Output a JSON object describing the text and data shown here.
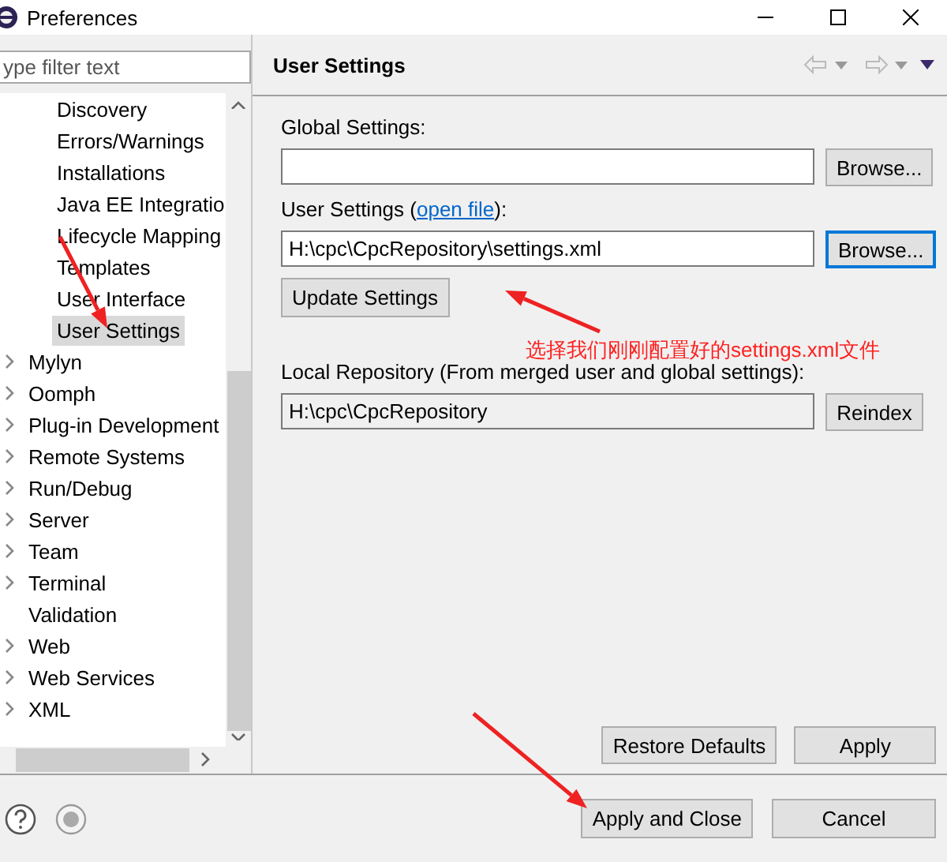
{
  "window": {
    "title": "Preferences"
  },
  "filter": {
    "placeholder": "ype filter text"
  },
  "tree": {
    "scrolled_children": [
      {
        "label": "Discovery",
        "selected": false
      },
      {
        "label": "Errors/Warnings",
        "selected": false
      },
      {
        "label": "Installations",
        "selected": false
      },
      {
        "label": "Java EE Integratio",
        "selected": false
      },
      {
        "label": "Lifecycle Mapping",
        "selected": false
      },
      {
        "label": "Templates",
        "selected": false
      },
      {
        "label": "User Interface",
        "selected": false
      },
      {
        "label": "User Settings",
        "selected": true
      }
    ],
    "items": [
      {
        "label": "Mylyn",
        "expandable": true,
        "selected": false
      },
      {
        "label": "Oomph",
        "expandable": true,
        "selected": false
      },
      {
        "label": "Plug-in Development",
        "expandable": true,
        "selected": false
      },
      {
        "label": "Remote Systems",
        "expandable": true,
        "selected": false
      },
      {
        "label": "Run/Debug",
        "expandable": true,
        "selected": false
      },
      {
        "label": "Server",
        "expandable": true,
        "selected": false
      },
      {
        "label": "Team",
        "expandable": true,
        "selected": false
      },
      {
        "label": "Terminal",
        "expandable": true,
        "selected": false
      },
      {
        "label": "Validation",
        "expandable": false,
        "selected": false
      },
      {
        "label": "Web",
        "expandable": true,
        "selected": false
      },
      {
        "label": "Web Services",
        "expandable": true,
        "selected": false
      },
      {
        "label": "XML",
        "expandable": true,
        "selected": false
      }
    ]
  },
  "page": {
    "title": "User Settings",
    "global_settings": {
      "label": "Global Settings:",
      "button": "Browse..."
    },
    "user_settings": {
      "label_before": "User Settings (",
      "link": "open file",
      "label_after": "):",
      "value": "H:\\cpc\\CpcRepository\\settings.xml",
      "button": "Browse...",
      "button_focused": true
    },
    "update_button": "Update Settings",
    "local_repository": {
      "label": "Local Repository (From merged user and global settings):",
      "value": "H:\\cpc\\CpcRepository",
      "button": "Reindex"
    },
    "restore_button": "Restore Defaults",
    "apply_button": "Apply"
  },
  "annotation": "选择我们刚刚配置好的settings.xml文件",
  "buttons": [
    "Apply and Close",
    "Cancel"
  ]
}
